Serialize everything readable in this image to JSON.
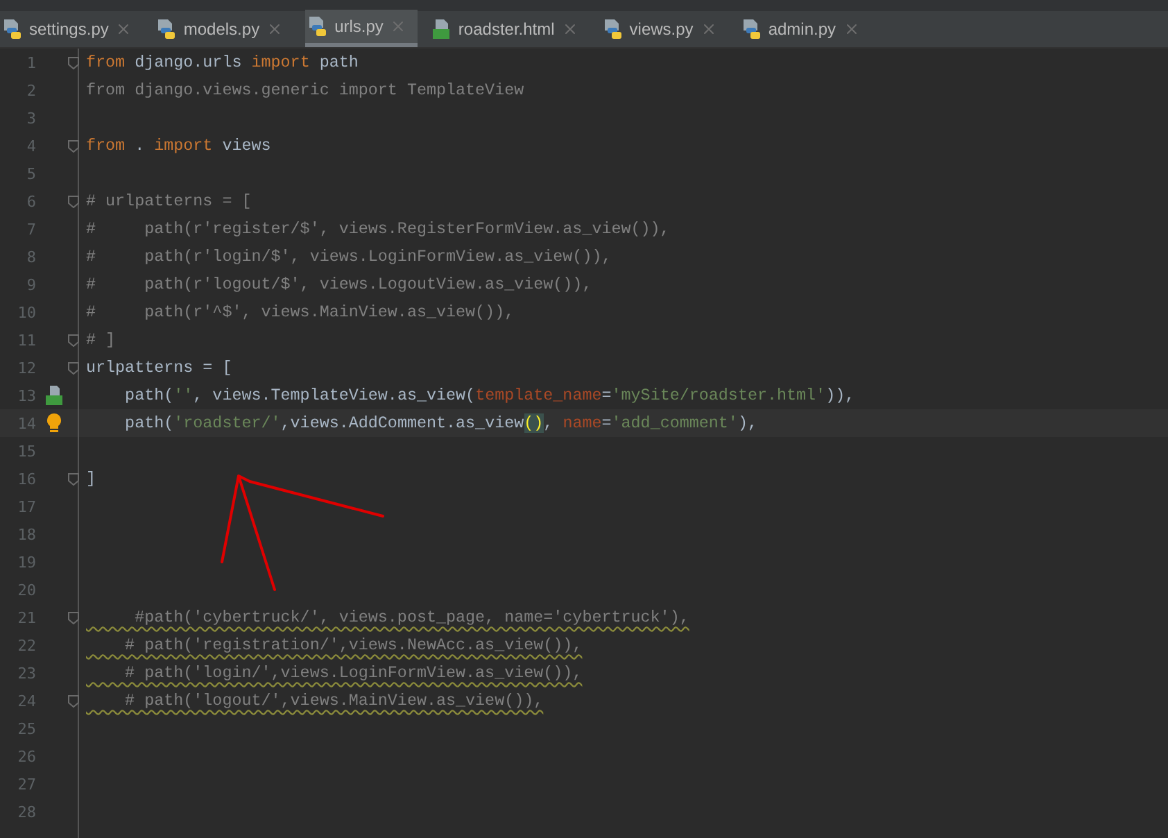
{
  "tabs": [
    {
      "label": "settings.py",
      "kind": "python",
      "selected": false
    },
    {
      "label": "models.py",
      "kind": "python",
      "selected": false
    },
    {
      "label": "urls.py",
      "kind": "python",
      "selected": true
    },
    {
      "label": "roadster.html",
      "kind": "html",
      "selected": false
    },
    {
      "label": "views.py",
      "kind": "python",
      "selected": false
    },
    {
      "label": "admin.py",
      "kind": "python",
      "selected": false
    }
  ],
  "editor": {
    "lines": [
      {
        "number": "1",
        "fold": true,
        "tokens": [
          {
            "text": "from",
            "kind": "keyword"
          },
          {
            "text": " django.urls ",
            "kind": "plain"
          },
          {
            "text": "import",
            "kind": "keyword"
          },
          {
            "text": " path",
            "kind": "plain"
          }
        ]
      },
      {
        "number": "2",
        "tokens": [
          {
            "text": "from django.views.generic import TemplateView",
            "kind": "unused"
          }
        ]
      },
      {
        "number": "3"
      },
      {
        "number": "4",
        "fold": true,
        "tokens": [
          {
            "text": "from",
            "kind": "keyword"
          },
          {
            "text": " . ",
            "kind": "plain"
          },
          {
            "text": "import",
            "kind": "keyword"
          },
          {
            "text": " views",
            "kind": "plain"
          }
        ]
      },
      {
        "number": "5"
      },
      {
        "number": "6",
        "fold": true,
        "tokens": [
          {
            "text": "# urlpatterns = [",
            "kind": "comment"
          }
        ]
      },
      {
        "number": "7",
        "tokens": [
          {
            "text": "#     path(r'register/$', views.RegisterFormView.as_view()),",
            "kind": "comment"
          }
        ]
      },
      {
        "number": "8",
        "tokens": [
          {
            "text": "#     path(r'login/$', views.LoginFormView.as_view()),",
            "kind": "comment"
          }
        ]
      },
      {
        "number": "9",
        "tokens": [
          {
            "text": "#     path(r'logout/$', views.LogoutView.as_view()),",
            "kind": "comment"
          }
        ]
      },
      {
        "number": "10",
        "tokens": [
          {
            "text": "#     path(r'^$', views.MainView.as_view()),",
            "kind": "comment"
          }
        ]
      },
      {
        "number": "11",
        "fold": true,
        "tokens": [
          {
            "text": "# ]",
            "kind": "comment"
          }
        ]
      },
      {
        "number": "12",
        "fold": true,
        "tokens": [
          {
            "text": "urlpatterns = [",
            "kind": "plain"
          }
        ]
      },
      {
        "number": "13",
        "gutter": {
          "kind": "html"
        },
        "tokens": [
          {
            "text": "    path(",
            "kind": "plain"
          },
          {
            "text": "''",
            "kind": "string"
          },
          {
            "text": ", views.TemplateView.as_view(",
            "kind": "plain"
          },
          {
            "text": "template_name",
            "kind": "param"
          },
          {
            "text": "=",
            "kind": "plain"
          },
          {
            "text": "'mySite/roadster.html'",
            "kind": "string"
          },
          {
            "text": ")),",
            "kind": "plain"
          }
        ]
      },
      {
        "number": "14",
        "gutter": {
          "kind": "bulb"
        },
        "current": true,
        "tokens": [
          {
            "text": "    path(",
            "kind": "plain"
          },
          {
            "text": "'roadster/'",
            "kind": "string"
          },
          {
            "text": ",views.AddComment.as_view",
            "kind": "plain"
          },
          {
            "text": "()",
            "kind": "match"
          },
          {
            "text": ", ",
            "kind": "plain"
          },
          {
            "text": "name",
            "kind": "param"
          },
          {
            "text": "=",
            "kind": "plain"
          },
          {
            "text": "'add_comment'",
            "kind": "string"
          },
          {
            "text": "),",
            "kind": "plain"
          }
        ]
      },
      {
        "number": "15"
      },
      {
        "number": "16",
        "fold": true,
        "tokens": [
          {
            "text": "]",
            "kind": "plain"
          }
        ]
      },
      {
        "number": "17"
      },
      {
        "number": "18"
      },
      {
        "number": "19"
      },
      {
        "number": "20"
      },
      {
        "number": "21",
        "fold": true,
        "tokens": [
          {
            "text": "     #path('cybertruck/', views.post_page, name='cybertruck'),",
            "kind": "warned"
          }
        ]
      },
      {
        "number": "22",
        "tokens": [
          {
            "text": "    # path('registration/',views.NewAcc.as_view()),",
            "kind": "warned"
          }
        ]
      },
      {
        "number": "23",
        "tokens": [
          {
            "text": "    # path('login/',views.LoginFormView.as_view()),",
            "kind": "warned"
          }
        ]
      },
      {
        "number": "24",
        "fold": true,
        "tokens": [
          {
            "text": "    # path('logout/',views.MainView.as_view()),",
            "kind": "warned"
          }
        ]
      },
      {
        "number": "25"
      },
      {
        "number": "26"
      },
      {
        "number": "27"
      },
      {
        "number": "28"
      }
    ]
  }
}
